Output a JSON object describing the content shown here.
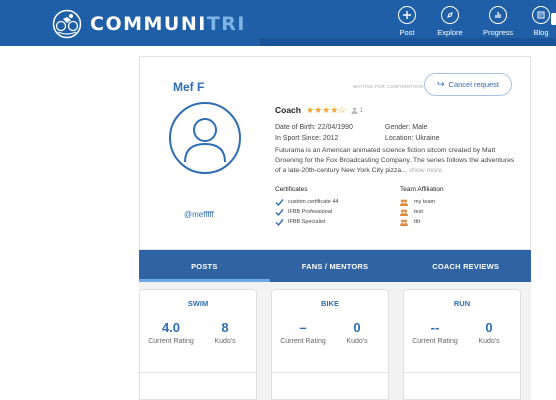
{
  "app": {
    "logo_text_main": "COMMUNI",
    "logo_text_accent": "TRI",
    "accent_color": "#1f5fa8"
  },
  "nav": {
    "items": [
      {
        "label": "Post",
        "icon": "plus-icon"
      },
      {
        "label": "Explore",
        "icon": "compass-icon"
      },
      {
        "label": "Progress",
        "icon": "bar-chart-icon"
      },
      {
        "label": "Blog",
        "icon": "blog-icon"
      }
    ]
  },
  "profile": {
    "name": "Mef F",
    "username": "@mefffff",
    "status": "WAITING FOR CONFIRMATION",
    "cancel_label": "Cancel request",
    "role": "Coach",
    "rating_stars": 4,
    "rating_max": 5,
    "rating_count": "1",
    "dob": "Date of Birth: 22/04/1990",
    "gender": "Gender: Male",
    "in_sport_since": "In Sport Since: 2012",
    "location": "Location: Ukraine",
    "bio": "Futurama is an American animated science fiction sitcom created by Matt Groening for the Fox Broadcasting Company. The series follows the adventures of a late-20th-century New York City pizza...",
    "show_more": "show more",
    "certificates_title": "Certificates",
    "certificates": [
      "custom certificate 44",
      "IFBB Professional",
      "IFBB Specialist"
    ],
    "teams_title": "Team Affiliation",
    "teams": [
      "my team",
      "test",
      "tttt"
    ]
  },
  "tabs": [
    {
      "label": "POSTS",
      "active": true
    },
    {
      "label": "FANS / MENTORS",
      "active": false
    },
    {
      "label": "COACH REVIEWS",
      "active": false
    }
  ],
  "sports": [
    {
      "title": "SWIM",
      "rating": "4.0",
      "kudos": "8",
      "rating_label": "Current Rating",
      "kudos_label": "Kudo's"
    },
    {
      "title": "BIKE",
      "rating": "–",
      "kudos": "0",
      "rating_label": "Current Rating",
      "kudos_label": "Kudo's"
    },
    {
      "title": "RUN",
      "rating": "--",
      "kudos": "0",
      "rating_label": "Current Rating",
      "kudos_label": "Kudo's"
    }
  ]
}
